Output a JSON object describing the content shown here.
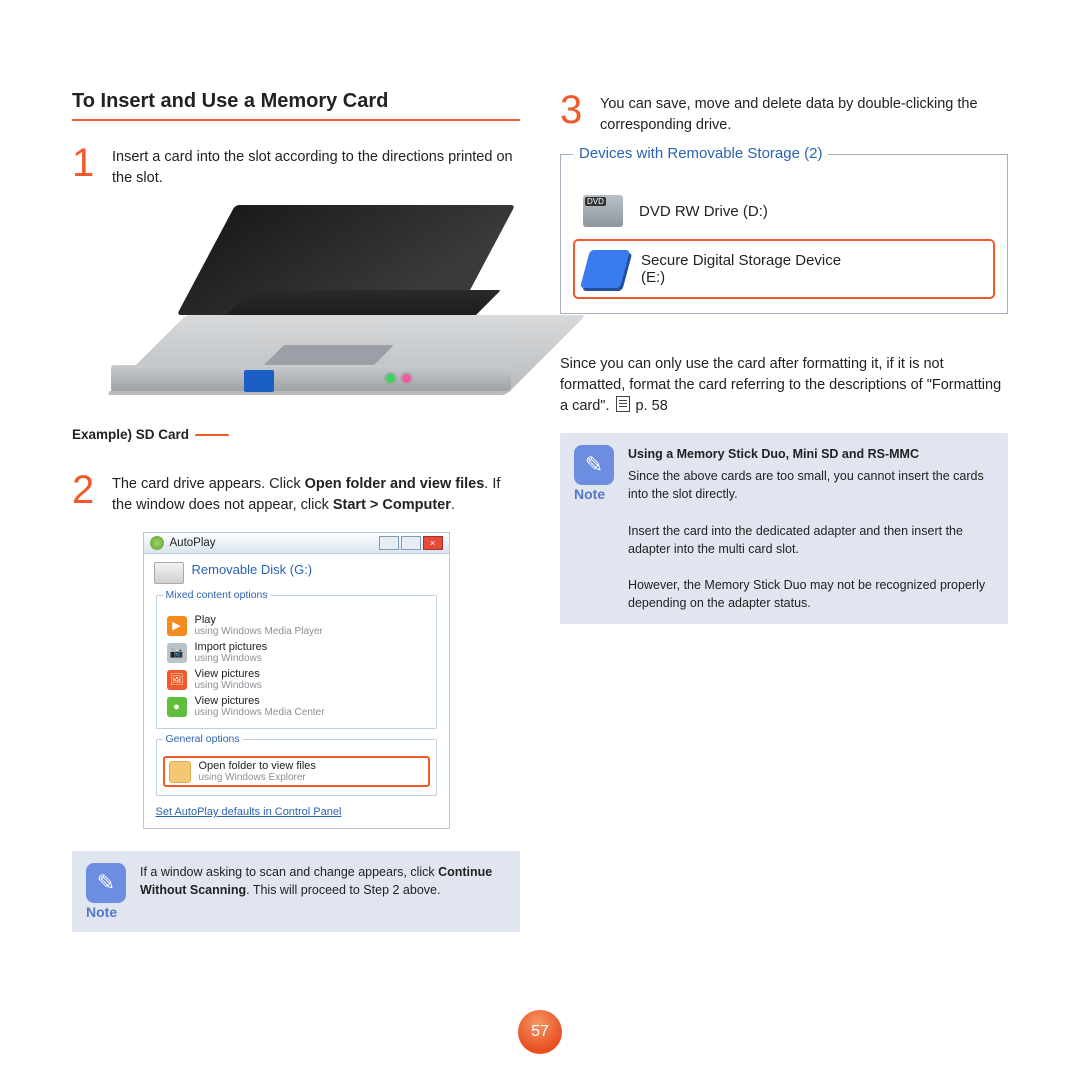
{
  "title": "To Insert and Use a Memory Card",
  "step1": {
    "num": "1",
    "text": "Insert a card into the slot according to the directions printed on the slot."
  },
  "sd_label": "Example) SD Card",
  "step2": {
    "num": "2",
    "pre": "The card drive appears. Click ",
    "b1": "Open folder and view files",
    "mid": ". If the window does not appear, click ",
    "b2": "Start > Computer",
    "post": "."
  },
  "ap": {
    "title": "AutoPlay",
    "hdr": "Removable Disk (G:)",
    "leg1": "Mixed content options",
    "opts": [
      {
        "k": "play",
        "t": "Play",
        "s": "using Windows Media Player"
      },
      {
        "k": "cam",
        "t": "Import pictures",
        "s": "using Windows"
      },
      {
        "k": "pic",
        "t": "View pictures",
        "s": "using Windows"
      },
      {
        "k": "mc",
        "t": "View pictures",
        "s": "using Windows Media Center"
      }
    ],
    "leg2": "General options",
    "open": {
      "t": "Open folder to view files",
      "s": "using Windows Explorer"
    },
    "link": "Set AutoPlay defaults in Control Panel"
  },
  "note1": {
    "lbl": "Note",
    "t1": "If a window asking to scan and change appears, click ",
    "b": "Continue Without Scanning",
    "t2": ". This will proceed to Step 2 above."
  },
  "step3": {
    "num": "3",
    "text": "You can save, move and delete data by double-clicking the corresponding drive."
  },
  "dev": {
    "hdr": "Devices with Removable Storage (2)",
    "r1": "DVD RW Drive (D:)",
    "r2a": "Secure Digital Storage Device",
    "r2b": "(E:)"
  },
  "format_text": {
    "p1": "Since you can only use the card after formatting it, if it is not formatted, format the card referring to the descriptions of \"Formatting a card\". ",
    "ref": "p. 58"
  },
  "note2": {
    "lbl": "Note",
    "title": "Using a Memory Stick Duo, Mini SD and RS-MMC",
    "p1": "Since the above cards are too small, you cannot insert the cards into the slot directly.",
    "p2": "Insert the card into the dedicated adapter and then insert the adapter into the multi card slot.",
    "p3": "However, the Memory Stick Duo may not be recognized properly depending on the adapter status."
  },
  "page_no": "57"
}
